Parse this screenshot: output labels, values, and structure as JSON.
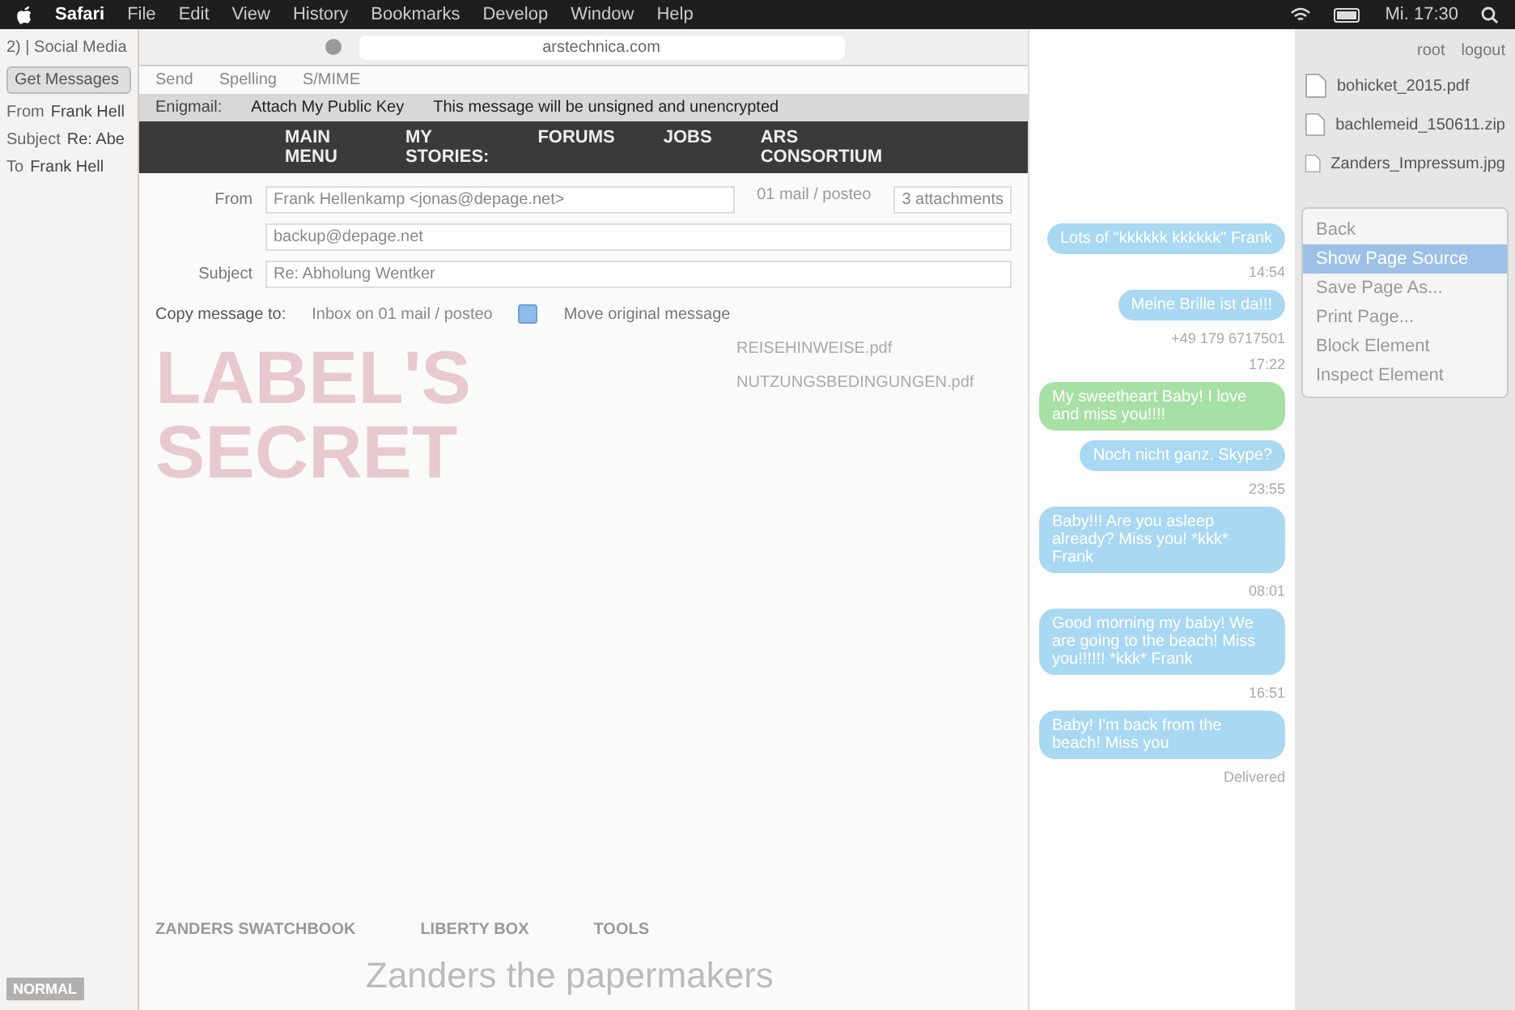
{
  "menu_bar": {
    "app": "Safari",
    "items": [
      "File",
      "Edit",
      "View",
      "History",
      "Bookmarks",
      "Develop",
      "Window",
      "Help"
    ],
    "clock": "Mi. 17:30"
  },
  "mail_reader": {
    "folder": "2) | Social Media",
    "get_messages": "Get Messages",
    "headers": [
      {
        "label": "From",
        "value": "Frank Hell"
      },
      {
        "label": "Subject",
        "value": "Re: Abe"
      },
      {
        "label": "To",
        "value": "Frank Hell"
      }
    ],
    "mode": "NORMAL"
  },
  "browser": {
    "address": "arstechnica.com",
    "nav": [
      "MAIN MENU",
      "MY STORIES:",
      "FORUMS",
      "JOBS",
      "ARS CONSORTIUM"
    ]
  },
  "compose": {
    "toolbar": [
      "Send",
      "Spelling",
      "S/MIME"
    ],
    "enigmail": {
      "label": "Enigmail:",
      "button": "Attach My Public Key",
      "status": "This message will be unsigned and unencrypted"
    },
    "from_label": "From",
    "from": "Frank Hellenkamp <jonas@depage.net>",
    "account": "01 mail / posteo",
    "attachments": "3 attachments",
    "recipients": [
      "backup@depage.net"
    ],
    "subject_label": "Subject",
    "subject": "Re: Abholung Wentker",
    "copy_label": "Copy message to:",
    "copy_folder": "Inbox on 01 mail / posteo",
    "move_original": {
      "label": "Move original message",
      "checked": true
    },
    "attachment_files": [
      "REISEHINWEISE.pdf",
      "NUTZUNGSBEDINGUNGEN.pdf"
    ]
  },
  "site": {
    "logo": "LABEL'S SECRET",
    "columns": [
      "ZANDERS SWATCHBOOK",
      "LIBERTY BOX",
      "TOOLS"
    ],
    "tagline": "Zanders the papermakers"
  },
  "chat": {
    "messages": [
      {
        "text": "Lots of \"kkkkkk kkkkkk\" Frank",
        "color": "#a9d8f2"
      },
      {
        "meta": "14:54"
      },
      {
        "text": "Meine Brille ist da!!!",
        "color": "#a9d8f2"
      },
      {
        "meta": "+49 179 6717501"
      },
      {
        "meta": "17:22"
      },
      {
        "text": "My sweetheart Baby! I love and miss you!!!!",
        "color": "#a7e0a4"
      },
      {
        "text": "Noch nicht ganz. Skype?",
        "color": "#a9d8f2"
      },
      {
        "meta": "23:55"
      },
      {
        "text": "Baby!!! Are you asleep already? Miss you! *kkk* Frank",
        "color": "#a9d8f2"
      },
      {
        "meta": "08:01"
      },
      {
        "text": "Good morning my baby! We are going to the beach! Miss you!!!!!! *kkk* Frank",
        "color": "#a9d8f2"
      },
      {
        "meta": "16:51"
      },
      {
        "text": "Baby! I'm back from the beach! Miss you",
        "color": "#a9d8f2"
      }
    ],
    "delivered": "Delivered"
  },
  "files": {
    "links": [
      "root",
      "logout"
    ],
    "items": [
      "bohicket_2015.pdf",
      "bachlemeid_150611.zip",
      "Zanders_Impressum.jpg"
    ]
  },
  "context_menu": [
    {
      "label": "Back",
      "selected": false
    },
    {
      "label": "Show Page Source",
      "selected": true
    },
    {
      "label": "Save Page As...",
      "selected": false
    },
    {
      "label": "Print Page...",
      "selected": false
    },
    {
      "label": "Block Element",
      "selected": false
    },
    {
      "label": "Inspect Element",
      "selected": false
    }
  ]
}
